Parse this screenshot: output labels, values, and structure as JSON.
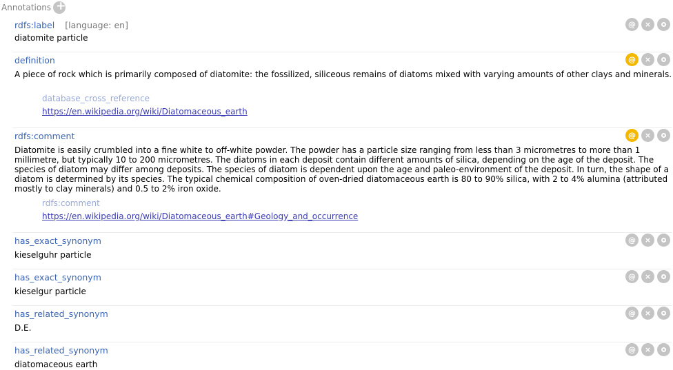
{
  "header": {
    "title": "Annotations",
    "add_icon": "plus-icon"
  },
  "annotations": [
    {
      "property": "rdfs:label",
      "language": "[language: en]",
      "value": "diatomite particle",
      "annotated": false
    },
    {
      "property": "definition",
      "value": "A piece of rock which is primarily composed of diatomite: the fossilized, siliceous remains of diatoms mixed with varying amounts of other clays and minerals.",
      "annotated": true,
      "nested": {
        "property": "database_cross_reference",
        "value": "https://en.wikipedia.org/wiki/Diatomaceous_earth"
      }
    },
    {
      "property": "rdfs:comment",
      "value": "Diatomite is easily crumbled into a fine white to off-white powder. The powder has a particle size ranging from less than 3 micrometres to more than 1 millimetre, but typically 10 to 200 micrometres. The diatoms in each deposit contain different amounts of silica, depending on the age of the deposit. The species of diatom may differ among deposits. The species of diatom is dependent upon the age and paleo-environment of the deposit. In turn, the shape of a diatom is determined by its species. The typical chemical composition of oven-dried diatomaceous earth is 80 to 90% silica, with 2 to 4% alumina (attributed mostly to clay minerals) and 0.5 to 2% iron oxide.",
      "annotated": true,
      "nested": {
        "property": "rdfs:comment",
        "value": "https://en.wikipedia.org/wiki/Diatomaceous_earth#Geology_and_occurrence"
      }
    },
    {
      "property": "has_exact_synonym",
      "value": "kieselguhr particle",
      "annotated": false
    },
    {
      "property": "has_exact_synonym",
      "value": "kieselgur particle",
      "annotated": false
    },
    {
      "property": "has_related_synonym",
      "value": "D.E.",
      "annotated": false
    },
    {
      "property": "has_related_synonym",
      "value": "diatomaceous earth",
      "annotated": false
    }
  ],
  "buttons": {
    "annotate": "@",
    "delete": "×"
  },
  "colors": {
    "active_annotate": "#f5b800",
    "inactive_button": "#c4c4c4",
    "property": "#3a64b4"
  }
}
